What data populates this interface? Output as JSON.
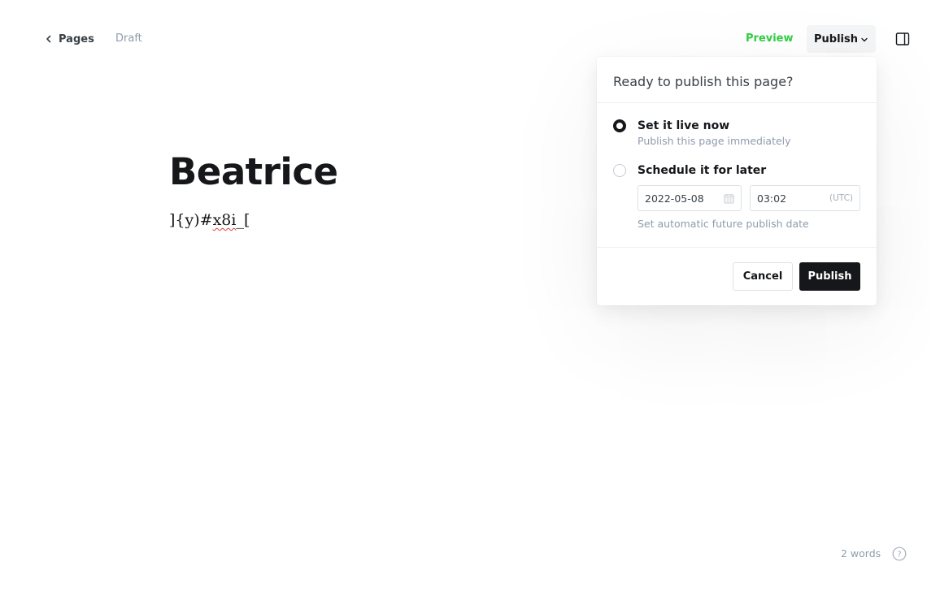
{
  "header": {
    "back_label": "Pages",
    "status": "Draft",
    "preview_label": "Preview",
    "publish_label": "Publish"
  },
  "editor": {
    "title": "Beatrice",
    "body_prefix": "]{y)#",
    "body_misspelled": "x8i",
    "body_suffix": "_["
  },
  "publish_menu": {
    "heading": "Ready to publish this page?",
    "options": [
      {
        "title": "Set it live now",
        "description": "Publish this page immediately",
        "selected": true
      },
      {
        "title": "Schedule it for later",
        "selected": false
      }
    ],
    "date_value": "2022-05-08",
    "time_value": "03:02",
    "timezone": "(UTC)",
    "schedule_hint": "Set automatic future publish date",
    "cancel_label": "Cancel",
    "publish_label": "Publish"
  },
  "footer": {
    "word_count": "2 words",
    "help_label": "?"
  },
  "colors": {
    "accent_green": "#30cf43",
    "text_dark": "#15171a",
    "text_muted": "#8e9cac"
  },
  "icons": {
    "back": "chevron-left-icon",
    "publish_dropdown": "chevron-down-icon",
    "sidebar": "sidebar-toggle-icon",
    "calendar": "calendar-icon",
    "help": "help-circle-icon"
  }
}
